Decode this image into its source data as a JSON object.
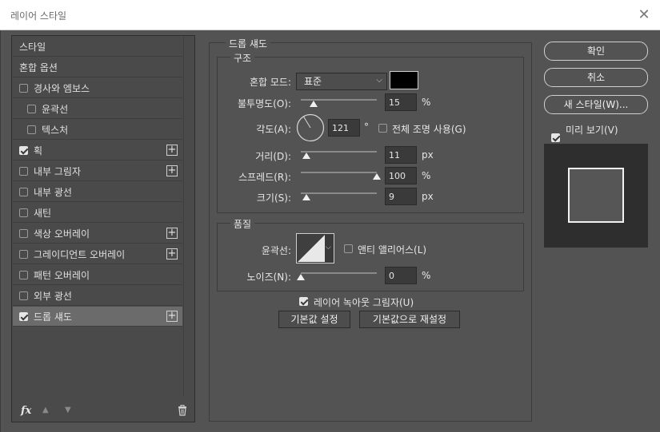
{
  "window": {
    "title": "레이어 스타일",
    "close_glyph": "✕"
  },
  "left_panel": {
    "items": [
      {
        "label": "스타일",
        "checkbox": null,
        "plus": false,
        "selected": false,
        "indent": 0
      },
      {
        "label": "혼합 옵션",
        "checkbox": null,
        "plus": false,
        "selected": false,
        "indent": 0
      },
      {
        "label": "경사와 엠보스",
        "checkbox": false,
        "plus": false,
        "selected": false,
        "indent": 0
      },
      {
        "label": "윤곽선",
        "checkbox": false,
        "plus": false,
        "selected": false,
        "indent": 1
      },
      {
        "label": "텍스처",
        "checkbox": false,
        "plus": false,
        "selected": false,
        "indent": 1
      },
      {
        "label": "획",
        "checkbox": true,
        "plus": true,
        "selected": false,
        "indent": 0
      },
      {
        "label": "내부 그림자",
        "checkbox": false,
        "plus": true,
        "selected": false,
        "indent": 0
      },
      {
        "label": "내부 광선",
        "checkbox": false,
        "plus": false,
        "selected": false,
        "indent": 0
      },
      {
        "label": "새틴",
        "checkbox": false,
        "plus": false,
        "selected": false,
        "indent": 0
      },
      {
        "label": "색상 오버레이",
        "checkbox": false,
        "plus": true,
        "selected": false,
        "indent": 0
      },
      {
        "label": "그레이디언트 오버레이",
        "checkbox": false,
        "plus": true,
        "selected": false,
        "indent": 0
      },
      {
        "label": "패턴 오버레이",
        "checkbox": false,
        "plus": false,
        "selected": false,
        "indent": 0
      },
      {
        "label": "외부 광선",
        "checkbox": false,
        "plus": false,
        "selected": false,
        "indent": 0
      },
      {
        "label": "드롭 섀도",
        "checkbox": true,
        "plus": true,
        "selected": true,
        "indent": 0
      }
    ],
    "footer": {
      "fx": "fx",
      "up_icon": "▲",
      "down_icon": "▼",
      "trash_icon": "🗑"
    }
  },
  "drop_shadow": {
    "section_title": "드롭 섀도",
    "structure": {
      "title": "구조",
      "blend_mode_label": "혼합 모드:",
      "blend_mode_value": "표준",
      "shadow_color": "#000000",
      "opacity_label": "불투명도(O):",
      "opacity_value": "15",
      "opacity_unit": "%",
      "opacity_level": 0.15,
      "angle_label": "각도(A):",
      "angle_value": "121",
      "angle_unit": "°",
      "global_light_label": "전체 조명 사용(G)",
      "global_light_checked": false,
      "distance_label": "거리(D):",
      "distance_value": "11",
      "distance_unit": "px",
      "spread_label": "스프레드(R):",
      "spread_value": "100",
      "spread_unit": "%",
      "size_label": "크기(S):",
      "size_value": "9",
      "size_unit": "px"
    },
    "quality": {
      "title": "품질",
      "contour_label": "윤곽선:",
      "anti_alias_label": "앤티 앨리어스(L)",
      "anti_alias_checked": false,
      "noise_label": "노이즈(N):",
      "noise_value": "0",
      "noise_unit": "%"
    },
    "knockout_label": "레이어 녹아웃 그림자(U)",
    "knockout_checked": true,
    "make_default_label": "기본값 설정",
    "reset_default_label": "기본값으로 재설정"
  },
  "right_panel": {
    "ok_label": "확인",
    "cancel_label": "취소",
    "new_style_label": "새 스타일(W)...",
    "preview_label": "미리 보기(V)",
    "preview_checked": true
  }
}
